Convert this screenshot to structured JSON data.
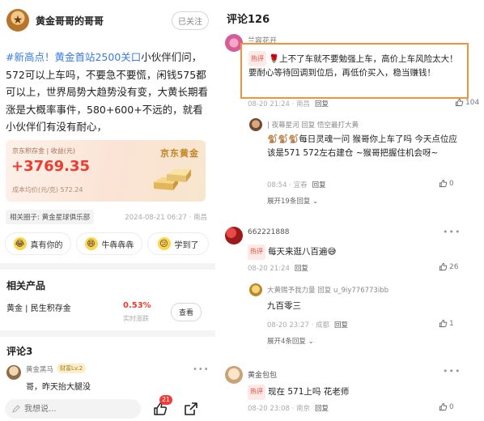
{
  "post": {
    "author": "黄金哥哥的哥哥",
    "follow_label": "已关注",
    "tag": "#新高点！黄金首站2500关口",
    "body": "小伙伴们问，572可以上车吗，不要急不要慌，闲钱575都可以上，世界局势大趋势没有变，大黄长期看涨是大概率事件，580+600+不远的，就看小伙伴们有没有耐心，",
    "card": {
      "label": "京东积存金 | 收益(元)",
      "profit": "+3769.35",
      "cost": "成本均价(元/克) 572.24",
      "brand": "京东黄金"
    },
    "circle": "相关圈子: 黄金星球俱乐部",
    "meta": "2024-08-21 06:27 · 南昌",
    "reactions": [
      {
        "emoji": "😂",
        "label": "真有你的"
      },
      {
        "emoji": "😄",
        "label": "牛犇犇犇"
      },
      {
        "emoji": "😕",
        "label": "学到了"
      }
    ]
  },
  "related": {
    "title": "相关产品",
    "product": "黄金 | 民生积存金",
    "pct": "0.53%",
    "pct_sub": "实时涨跌",
    "view": "查看"
  },
  "comments_left": {
    "title": "评论3",
    "first": {
      "name": "黄金黑马",
      "badge": "财富Lv.2",
      "text": "哥，昨天抬大腿没"
    }
  },
  "bottom": {
    "placeholder": "我想说...",
    "like_count": "21"
  },
  "right": {
    "title": "评论126",
    "hot_label": "热评",
    "c1": {
      "name": "兰容花开",
      "text": "上不了车就不要勉强上车，高价上车风险太大！要耐心等待回调到位后，再低价买入，稳当赚钱！",
      "meta": "08-20 21:24 · 南昌",
      "reply": "回复",
      "likes": "104"
    },
    "c1_reply": {
      "name": "| 夜幕星河",
      "reply_to_prefix": "回复",
      "reply_to": "悟空最打大黄",
      "text": "🐒🐒🐒每日灵魂一问 猴哥你上车了吗 今天点位应该是571 572左右建仓 ~猴哥把握住机会呀~",
      "meta": "08:54 · 宜春",
      "reply": "回复",
      "likes": "0",
      "expand": "展开19条回复"
    },
    "c2": {
      "name": "662221888",
      "text": "每天来逛八百遍😅",
      "meta": "08-20 21:24",
      "reply": "回复",
      "likes": "26"
    },
    "c2_reply": {
      "name": "大黄赐予我力量",
      "reply_to_prefix": "回复",
      "reply_to": "u_9iy776773ibb",
      "text": "九百零三",
      "meta": "08-20 23:27 · 成都",
      "reply": "回复",
      "likes": "1",
      "expand": "展开4条回复"
    },
    "c3": {
      "name": "黄金包包",
      "text": "现在 571上吗 花老师",
      "meta": "08-20 23:08 · 南京",
      "reply": "回复",
      "likes": "0"
    }
  },
  "colors": {
    "accent_red": "#ec3b30",
    "link_blue": "#3a7be0",
    "highlight_orange": "#f0933a"
  }
}
